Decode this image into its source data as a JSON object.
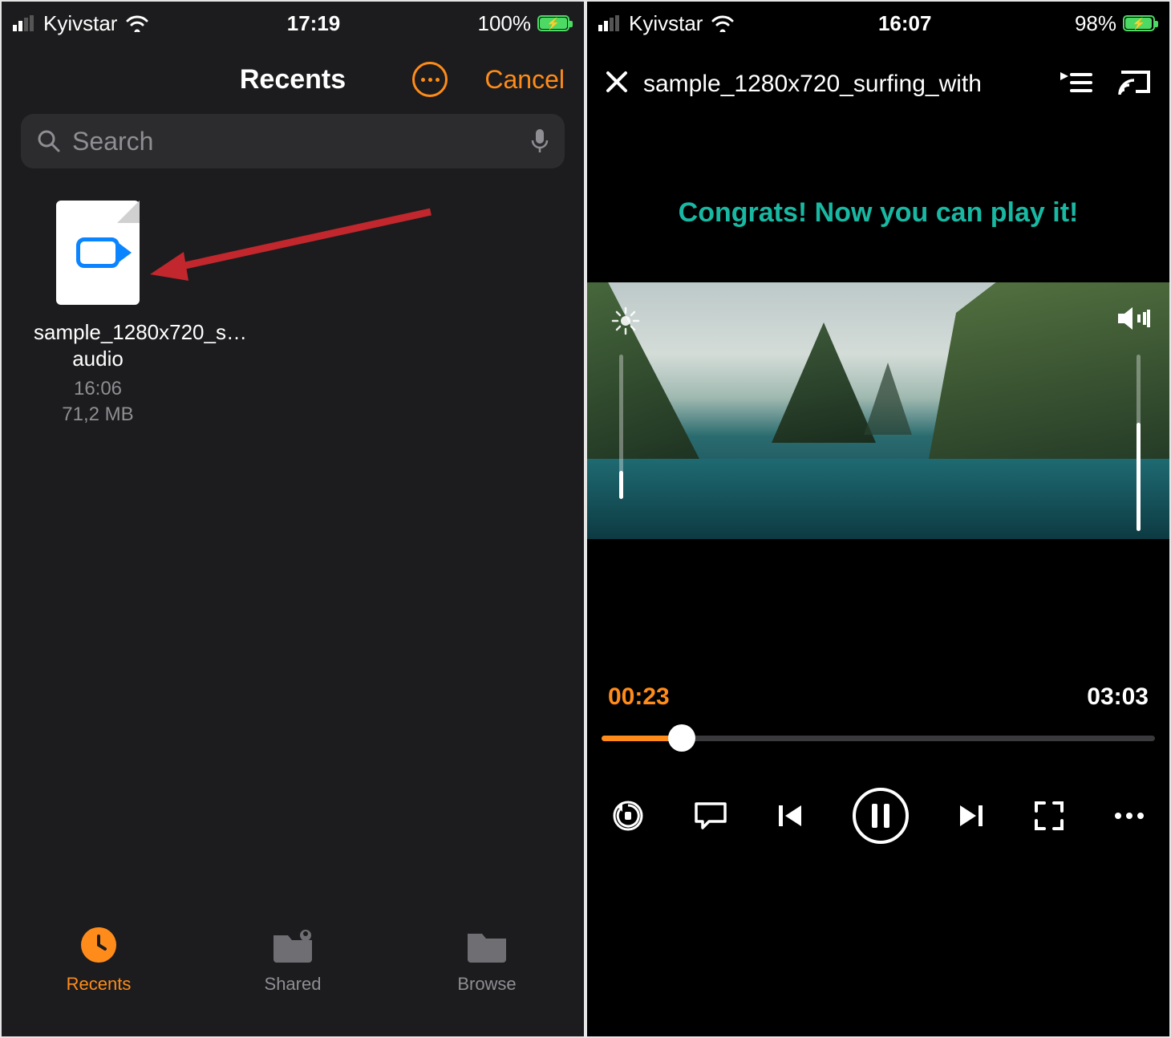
{
  "left": {
    "status": {
      "carrier": "Kyivstar",
      "time": "17:19",
      "battery": "100%"
    },
    "header": {
      "title": "Recents",
      "cancel": "Cancel"
    },
    "search": {
      "placeholder": "Search"
    },
    "file": {
      "name": "sample_1280x720_s…audio",
      "time": "16:06",
      "size": "71,2 MB"
    },
    "tabs": {
      "recents": "Recents",
      "shared": "Shared",
      "browse": "Browse"
    }
  },
  "right": {
    "status": {
      "carrier": "Kyivstar",
      "time": "16:07",
      "battery": "98%"
    },
    "header": {
      "title": "sample_1280x720_surfing_with"
    },
    "congrats": "Congrats! Now you can play it!",
    "time": {
      "current": "00:23",
      "duration": "03:03"
    }
  }
}
